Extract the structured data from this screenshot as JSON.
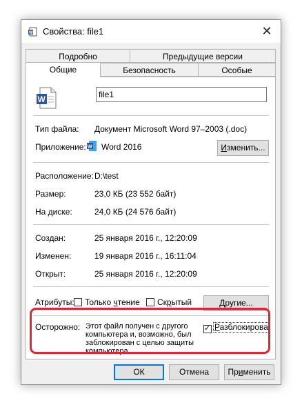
{
  "window": {
    "title": "Свойства: file1",
    "close_glyph": "✕"
  },
  "tabs": {
    "row1": [
      "Подробно",
      "Предыдущие версии"
    ],
    "row2": [
      "Общие",
      "Безопасность",
      "Особые"
    ],
    "active": "Общие"
  },
  "general": {
    "file_name": "file1",
    "file_type_label": "Тип файла:",
    "file_type_value": "Документ Microsoft Word 97–2003 (.doc)",
    "app_label": "Приложение:",
    "app_value": "Word 2016",
    "change_button": "Изменить...",
    "location_label": "Расположение:",
    "location_value": "D:\\test",
    "size_label": "Размер:",
    "size_value": "23,0 КБ (23 552 байт)",
    "disk_label": "На диске:",
    "disk_value": "24,0 КБ (24 576 байт)",
    "created_label": "Создан:",
    "created_value": "25 января 2016 г., 12:20:09",
    "modified_label": "Изменен:",
    "modified_value": "19 января 2016 г., 16:11:04",
    "opened_label": "Открыт:",
    "opened_value": "25 января 2016 г., 12:20:09",
    "attributes_label": "Атрибуты:",
    "readonly_label": "Только чтение",
    "readonly_checked": false,
    "hidden_label": "Скрытый",
    "hidden_checked": false,
    "other_button": "Другие...",
    "caution_label": "Осторожно:",
    "caution_text": [
      "Этот файл получен с другого",
      "компьютера и, возможно, был",
      "заблокирован с целью защиты",
      "компьютера."
    ],
    "unblock_label": "Разблокировать",
    "unblock_checked": true
  },
  "footer": {
    "ok": "ОК",
    "cancel": "Отмена",
    "apply": "Применить"
  },
  "colors": {
    "highlight": "#e0262f",
    "word_blue": "#2b579a",
    "focus_blue": "#0078d7"
  },
  "icons": [
    "word-document-icon",
    "word-app-icon",
    "close-icon"
  ]
}
